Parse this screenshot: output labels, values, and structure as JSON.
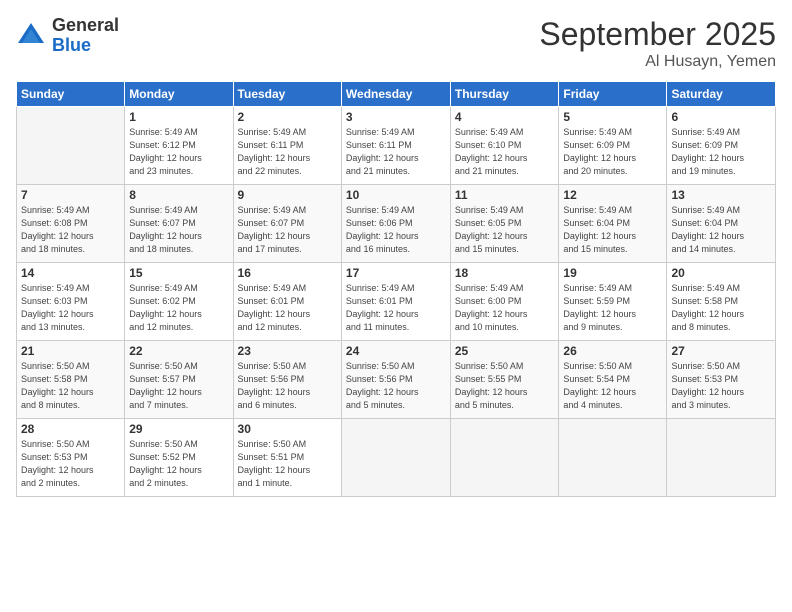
{
  "logo": {
    "general": "General",
    "blue": "Blue"
  },
  "title": "September 2025",
  "location": "Al Husayn, Yemen",
  "headers": [
    "Sunday",
    "Monday",
    "Tuesday",
    "Wednesday",
    "Thursday",
    "Friday",
    "Saturday"
  ],
  "weeks": [
    [
      {
        "day": "",
        "info": ""
      },
      {
        "day": "1",
        "info": "Sunrise: 5:49 AM\nSunset: 6:12 PM\nDaylight: 12 hours\nand 23 minutes."
      },
      {
        "day": "2",
        "info": "Sunrise: 5:49 AM\nSunset: 6:11 PM\nDaylight: 12 hours\nand 22 minutes."
      },
      {
        "day": "3",
        "info": "Sunrise: 5:49 AM\nSunset: 6:11 PM\nDaylight: 12 hours\nand 21 minutes."
      },
      {
        "day": "4",
        "info": "Sunrise: 5:49 AM\nSunset: 6:10 PM\nDaylight: 12 hours\nand 21 minutes."
      },
      {
        "day": "5",
        "info": "Sunrise: 5:49 AM\nSunset: 6:09 PM\nDaylight: 12 hours\nand 20 minutes."
      },
      {
        "day": "6",
        "info": "Sunrise: 5:49 AM\nSunset: 6:09 PM\nDaylight: 12 hours\nand 19 minutes."
      }
    ],
    [
      {
        "day": "7",
        "info": "Sunrise: 5:49 AM\nSunset: 6:08 PM\nDaylight: 12 hours\nand 18 minutes."
      },
      {
        "day": "8",
        "info": "Sunrise: 5:49 AM\nSunset: 6:07 PM\nDaylight: 12 hours\nand 18 minutes."
      },
      {
        "day": "9",
        "info": "Sunrise: 5:49 AM\nSunset: 6:07 PM\nDaylight: 12 hours\nand 17 minutes."
      },
      {
        "day": "10",
        "info": "Sunrise: 5:49 AM\nSunset: 6:06 PM\nDaylight: 12 hours\nand 16 minutes."
      },
      {
        "day": "11",
        "info": "Sunrise: 5:49 AM\nSunset: 6:05 PM\nDaylight: 12 hours\nand 15 minutes."
      },
      {
        "day": "12",
        "info": "Sunrise: 5:49 AM\nSunset: 6:04 PM\nDaylight: 12 hours\nand 15 minutes."
      },
      {
        "day": "13",
        "info": "Sunrise: 5:49 AM\nSunset: 6:04 PM\nDaylight: 12 hours\nand 14 minutes."
      }
    ],
    [
      {
        "day": "14",
        "info": "Sunrise: 5:49 AM\nSunset: 6:03 PM\nDaylight: 12 hours\nand 13 minutes."
      },
      {
        "day": "15",
        "info": "Sunrise: 5:49 AM\nSunset: 6:02 PM\nDaylight: 12 hours\nand 12 minutes."
      },
      {
        "day": "16",
        "info": "Sunrise: 5:49 AM\nSunset: 6:01 PM\nDaylight: 12 hours\nand 12 minutes."
      },
      {
        "day": "17",
        "info": "Sunrise: 5:49 AM\nSunset: 6:01 PM\nDaylight: 12 hours\nand 11 minutes."
      },
      {
        "day": "18",
        "info": "Sunrise: 5:49 AM\nSunset: 6:00 PM\nDaylight: 12 hours\nand 10 minutes."
      },
      {
        "day": "19",
        "info": "Sunrise: 5:49 AM\nSunset: 5:59 PM\nDaylight: 12 hours\nand 9 minutes."
      },
      {
        "day": "20",
        "info": "Sunrise: 5:49 AM\nSunset: 5:58 PM\nDaylight: 12 hours\nand 8 minutes."
      }
    ],
    [
      {
        "day": "21",
        "info": "Sunrise: 5:50 AM\nSunset: 5:58 PM\nDaylight: 12 hours\nand 8 minutes."
      },
      {
        "day": "22",
        "info": "Sunrise: 5:50 AM\nSunset: 5:57 PM\nDaylight: 12 hours\nand 7 minutes."
      },
      {
        "day": "23",
        "info": "Sunrise: 5:50 AM\nSunset: 5:56 PM\nDaylight: 12 hours\nand 6 minutes."
      },
      {
        "day": "24",
        "info": "Sunrise: 5:50 AM\nSunset: 5:56 PM\nDaylight: 12 hours\nand 5 minutes."
      },
      {
        "day": "25",
        "info": "Sunrise: 5:50 AM\nSunset: 5:55 PM\nDaylight: 12 hours\nand 5 minutes."
      },
      {
        "day": "26",
        "info": "Sunrise: 5:50 AM\nSunset: 5:54 PM\nDaylight: 12 hours\nand 4 minutes."
      },
      {
        "day": "27",
        "info": "Sunrise: 5:50 AM\nSunset: 5:53 PM\nDaylight: 12 hours\nand 3 minutes."
      }
    ],
    [
      {
        "day": "28",
        "info": "Sunrise: 5:50 AM\nSunset: 5:53 PM\nDaylight: 12 hours\nand 2 minutes."
      },
      {
        "day": "29",
        "info": "Sunrise: 5:50 AM\nSunset: 5:52 PM\nDaylight: 12 hours\nand 2 minutes."
      },
      {
        "day": "30",
        "info": "Sunrise: 5:50 AM\nSunset: 5:51 PM\nDaylight: 12 hours\nand 1 minute."
      },
      {
        "day": "",
        "info": ""
      },
      {
        "day": "",
        "info": ""
      },
      {
        "day": "",
        "info": ""
      },
      {
        "day": "",
        "info": ""
      }
    ]
  ]
}
